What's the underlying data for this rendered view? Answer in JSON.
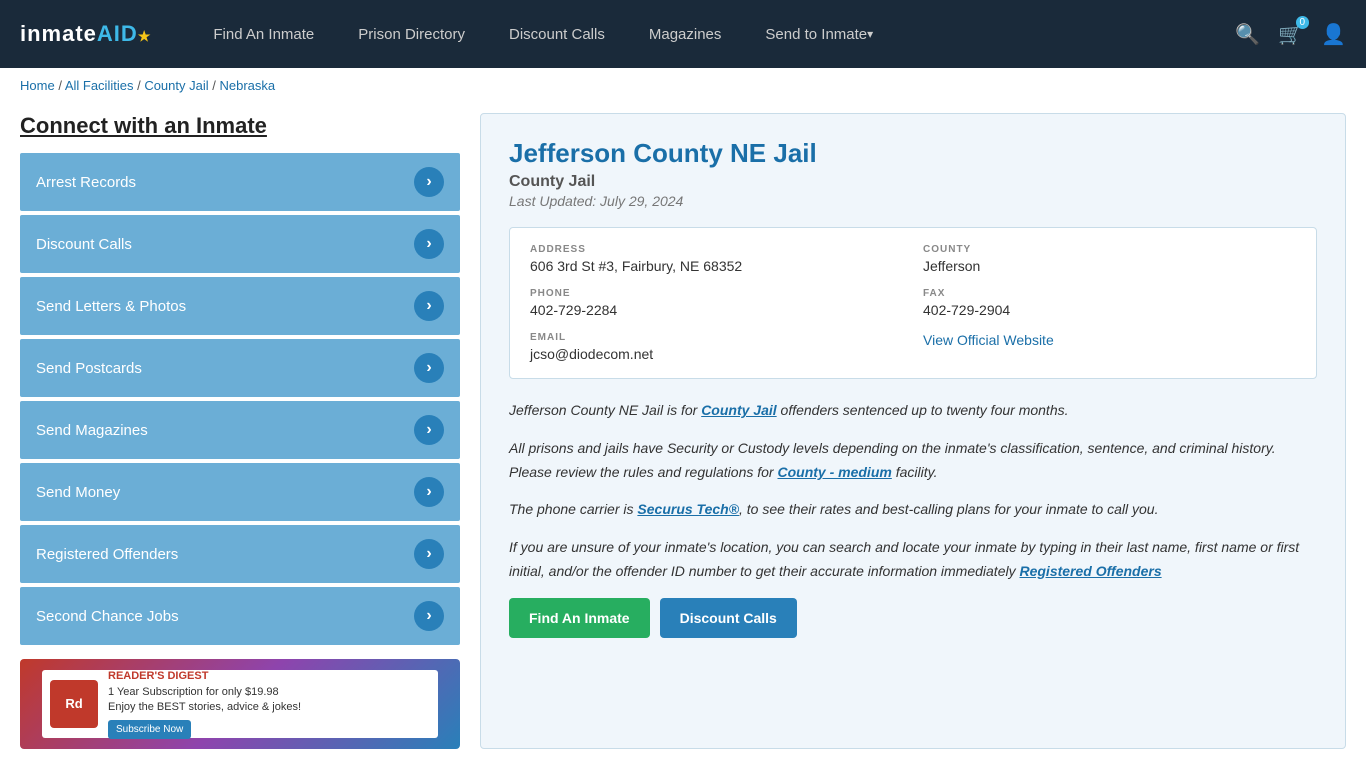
{
  "nav": {
    "logo_inmate": "inmate",
    "logo_aid": "AID",
    "logo_star": "★",
    "links": [
      {
        "label": "Find An Inmate",
        "id": "find-inmate",
        "dropdown": false
      },
      {
        "label": "Prison Directory",
        "id": "prison-directory",
        "dropdown": false
      },
      {
        "label": "Discount Calls",
        "id": "discount-calls",
        "dropdown": false
      },
      {
        "label": "Magazines",
        "id": "magazines",
        "dropdown": false
      },
      {
        "label": "Send to Inmate",
        "id": "send-to-inmate",
        "dropdown": true
      }
    ],
    "cart_count": "0",
    "search_icon": "🔍",
    "cart_icon": "🛒",
    "user_icon": "👤"
  },
  "breadcrumb": {
    "home": "Home",
    "all_facilities": "All Facilities",
    "county_jail": "County Jail",
    "state": "Nebraska"
  },
  "sidebar": {
    "title": "Connect with an Inmate",
    "menu_items": [
      {
        "label": "Arrest Records",
        "id": "arrest-records"
      },
      {
        "label": "Discount Calls",
        "id": "discount-calls-side"
      },
      {
        "label": "Send Letters & Photos",
        "id": "send-letters"
      },
      {
        "label": "Send Postcards",
        "id": "send-postcards"
      },
      {
        "label": "Send Magazines",
        "id": "send-magazines"
      },
      {
        "label": "Send Money",
        "id": "send-money"
      },
      {
        "label": "Registered Offenders",
        "id": "registered-offenders"
      },
      {
        "label": "Second Chance Jobs",
        "id": "second-chance-jobs"
      }
    ],
    "ad": {
      "logo_text": "Rd",
      "logo_subtext": "READER'S DIGEST",
      "headline": "1 Year Subscription for only $19.98",
      "subtext": "Enjoy the BEST stories, advice & jokes!",
      "button_label": "Subscribe Now"
    }
  },
  "facility": {
    "title": "Jefferson County NE Jail",
    "type": "County Jail",
    "last_updated": "Last Updated: July 29, 2024",
    "address_label": "ADDRESS",
    "address_value": "606 3rd St #3, Fairbury, NE 68352",
    "county_label": "COUNTY",
    "county_value": "Jefferson",
    "phone_label": "PHONE",
    "phone_value": "402-729-2284",
    "fax_label": "FAX",
    "fax_value": "402-729-2904",
    "email_label": "EMAIL",
    "email_value": "jcso@diodecom.net",
    "website_label": "View Official Website",
    "website_url": "#"
  },
  "description": {
    "para1_pre": "Jefferson County NE Jail is for ",
    "para1_link": "County Jail",
    "para1_post": " offenders sentenced up to twenty four months.",
    "para2": "All prisons and jails have Security or Custody levels depending on the inmate's classification, sentence, and criminal history. Please review the rules and regulations for ",
    "para2_link": "County - medium",
    "para2_post": " facility.",
    "para3_pre": "The phone carrier is ",
    "para3_link": "Securus Tech®",
    "para3_post": ", to see their rates and best-calling plans for your inmate to call you.",
    "para4": "If you are unsure of your inmate's location, you can search and locate your inmate by typing in their last name, first name or first initial, and/or the offender ID number to get their accurate information immediately",
    "para4_link": "Registered Offenders"
  },
  "bottom_buttons": {
    "btn1": "Find An Inmate",
    "btn2": "Discount Calls"
  }
}
